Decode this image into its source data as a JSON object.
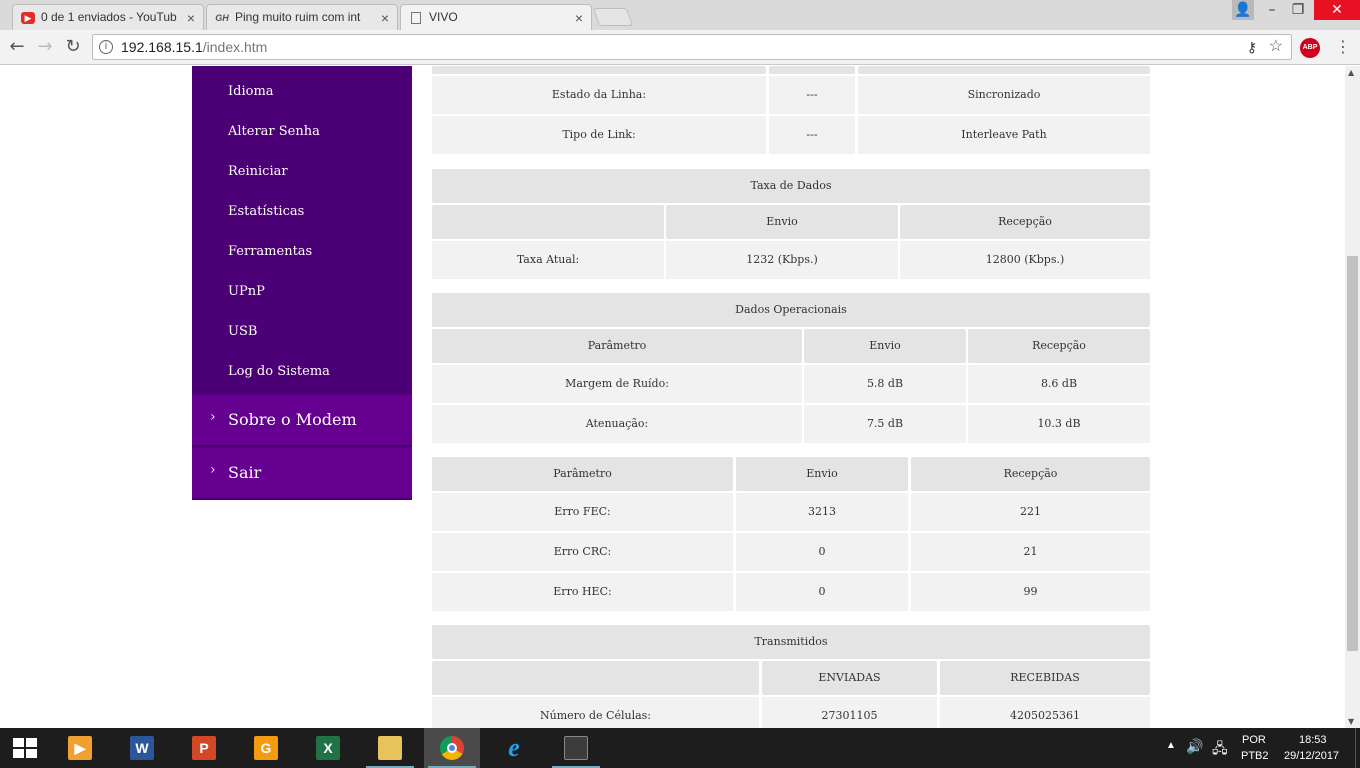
{
  "browser": {
    "tabs": [
      {
        "title": "0 de 1 enviados - YouTub",
        "icon": "youtube-icon",
        "active": false
      },
      {
        "title": "Ping muito ruim com int",
        "icon": "gh-site-icon",
        "active": false
      },
      {
        "title": "VIVO",
        "icon": "page-icon",
        "active": true
      }
    ],
    "address_host": "192.168.15.1",
    "address_path": "/index.htm",
    "abp_label": "ABP"
  },
  "sidebar": {
    "items": [
      "Idioma",
      "Alterar Senha",
      "Reiniciar",
      "Estatísticas",
      "Ferramentas",
      "UPnP",
      "USB",
      "Log do Sistema"
    ],
    "main": [
      {
        "label": "Sobre o Modem"
      },
      {
        "label": "Sair"
      }
    ]
  },
  "line_status": {
    "rows": [
      {
        "label": "Estado da Linha:",
        "mid": "---",
        "value": "Sincronizado"
      },
      {
        "label": "Tipo de Link:",
        "mid": "---",
        "value": "Interleave Path"
      }
    ]
  },
  "data_rate": {
    "title": "Taxa de Dados",
    "headers": [
      "",
      "Envio",
      "Recepção"
    ],
    "rows": [
      {
        "label": "Taxa Atual:",
        "send": "1232 (Kbps.)",
        "recv": "12800 (Kbps.)"
      }
    ]
  },
  "operational": {
    "title": "Dados Operacionais",
    "headers": [
      "Parâmetro",
      "Envio",
      "Recepção"
    ],
    "rows": [
      {
        "label": "Margem de Ruído:",
        "send": "5.8 dB",
        "recv": "8.6 dB"
      },
      {
        "label": "Atenuação:",
        "send": "7.5 dB",
        "recv": "10.3 dB"
      }
    ]
  },
  "errors": {
    "headers": [
      "Parâmetro",
      "Envio",
      "Recepção"
    ],
    "rows": [
      {
        "label": "Erro FEC:",
        "send": "3213",
        "recv": "221"
      },
      {
        "label": "Erro CRC:",
        "send": "0",
        "recv": "21"
      },
      {
        "label": "Erro HEC:",
        "send": "0",
        "recv": "99"
      }
    ]
  },
  "transmitted": {
    "title": "Transmitidos",
    "headers": [
      "",
      "ENVIADAS",
      "RECEBIDAS"
    ],
    "rows": [
      {
        "label": "Número de Células:",
        "send": "27301105",
        "recv": "4205025361"
      }
    ]
  },
  "taskbar": {
    "apps": [
      {
        "name": "windows-start-icon"
      },
      {
        "name": "media-player-icon"
      },
      {
        "name": "word-icon",
        "glyph": "W"
      },
      {
        "name": "powerpoint-icon",
        "glyph": "P"
      },
      {
        "name": "foxit-pdf-icon",
        "glyph": "G"
      },
      {
        "name": "excel-icon",
        "glyph": "X"
      },
      {
        "name": "file-explorer-icon"
      },
      {
        "name": "chrome-icon"
      },
      {
        "name": "internet-explorer-icon",
        "glyph": "e"
      },
      {
        "name": "game-app-icon"
      }
    ],
    "lang_top": "POR",
    "lang_bottom": "PTB2",
    "time": "18:53",
    "date": "29/12/2017"
  },
  "colors": {
    "sidebar_bg": "#4b0076",
    "sidebar_main_bg": "#650091",
    "table_header_bg": "#e4e4e4",
    "table_row_bg": "#f2f2f2"
  }
}
